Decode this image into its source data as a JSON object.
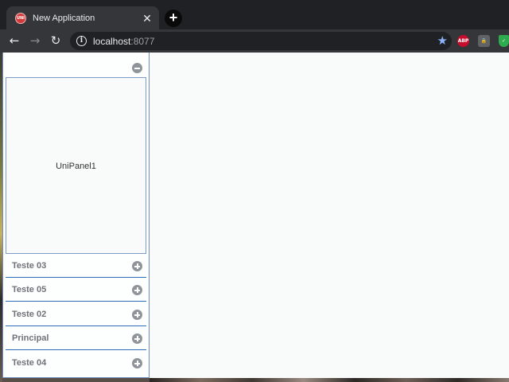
{
  "browser": {
    "tab_title": "New Application",
    "favicon_label": "UNI",
    "close_glyph": "✕",
    "newtab_glyph": "+",
    "back_glyph": "←",
    "forward_glyph": "→",
    "reload_glyph": "↻",
    "url_host": "localhost",
    "url_port": ":8077",
    "info_glyph": "i",
    "star_glyph": "★",
    "extensions": [
      {
        "name": "adblock-plus-icon",
        "label": "ABP"
      },
      {
        "name": "password-manager-icon",
        "label": "🔒"
      },
      {
        "name": "shield-icon",
        "label": "✓"
      }
    ]
  },
  "accordion": {
    "expanded_panel": {
      "caption": "UniPanel1"
    },
    "items": [
      {
        "label": "Teste 03"
      },
      {
        "label": "Teste 05"
      },
      {
        "label": "Teste 02"
      },
      {
        "label": "Principal"
      },
      {
        "label": "Teste 04"
      }
    ]
  }
}
